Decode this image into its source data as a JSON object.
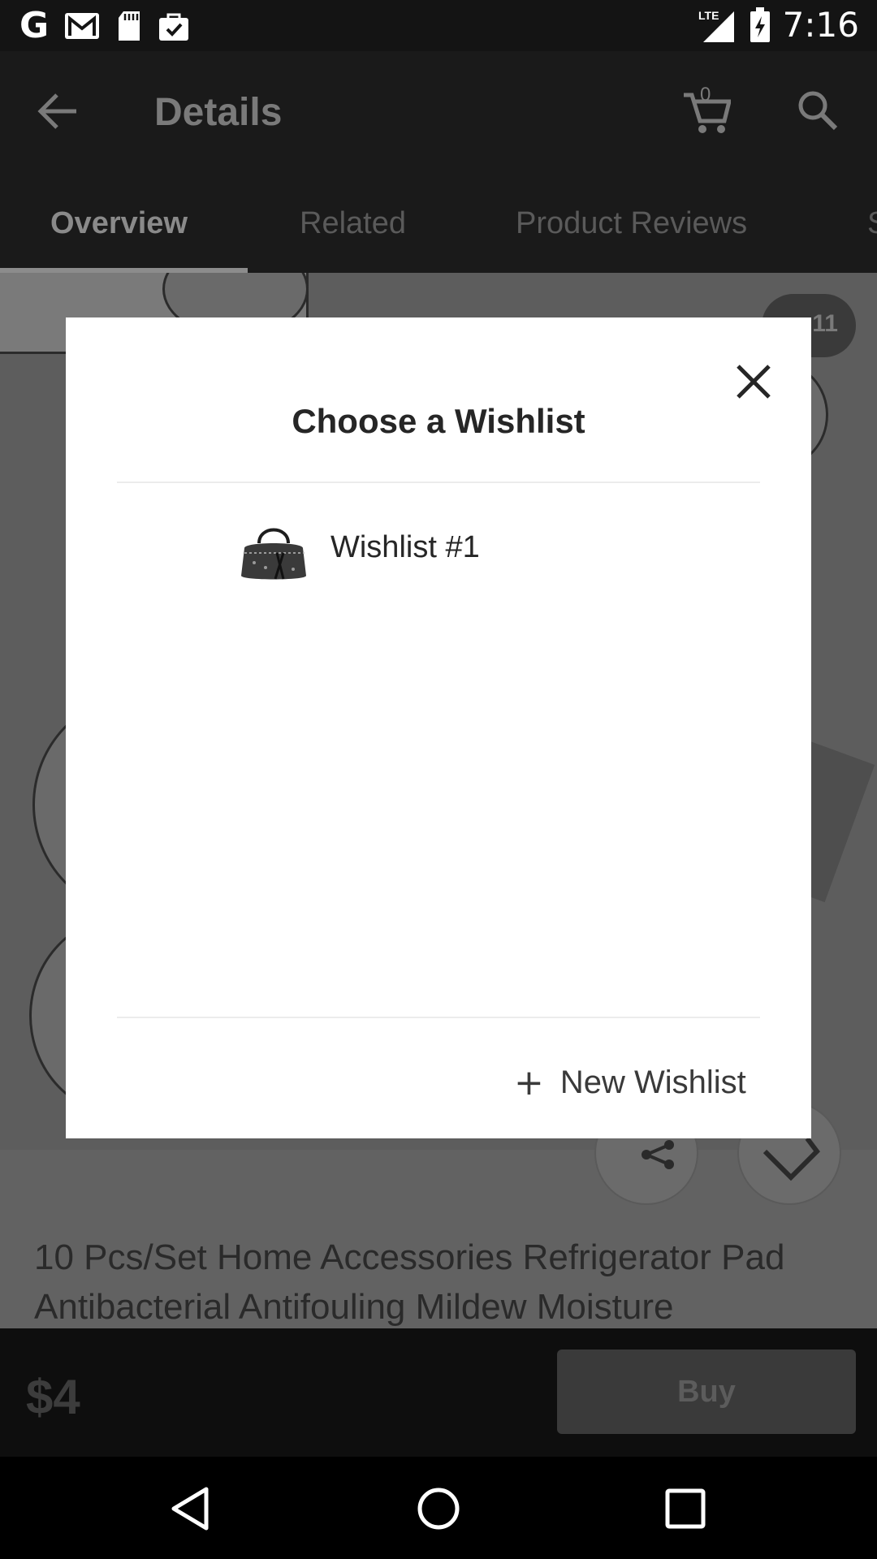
{
  "status_bar": {
    "time": "7:16",
    "network": "LTE"
  },
  "app_bar": {
    "title": "Details",
    "cart_count": "0"
  },
  "tabs": [
    {
      "label": "Overview"
    },
    {
      "label": "Related"
    },
    {
      "label": "Product Reviews"
    },
    {
      "label": "S"
    }
  ],
  "product": {
    "image_count": "11",
    "title": "10 Pcs/Set Home Accessories Refrigerator Pad Antibacterial Antifouling Mildew Moisture",
    "price": "$4",
    "buy_label": "Buy"
  },
  "dialog": {
    "title": "Choose a Wishlist",
    "wishlists": [
      {
        "name": "Wishlist #1",
        "thumbnail": "handbag-image"
      }
    ],
    "new_wishlist_label": "New Wishlist"
  },
  "icons": {
    "back": "arrow-left-icon",
    "cart": "cart-icon",
    "search": "search-icon",
    "close": "close-icon",
    "share": "share-icon",
    "wishlist": "heart-icon",
    "plus": "plus-icon"
  }
}
